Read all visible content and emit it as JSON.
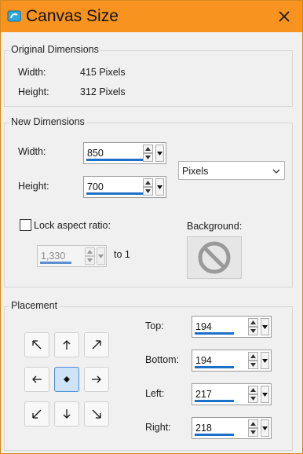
{
  "window": {
    "title": "Canvas Size"
  },
  "original": {
    "title": "Original Dimensions",
    "width_label": "Width:",
    "width_value": "415 Pixels",
    "height_label": "Height:",
    "height_value": "312 Pixels"
  },
  "new_dims": {
    "title": "New Dimensions",
    "width_label": "Width:",
    "width_value": "850",
    "height_label": "Height:",
    "height_value": "700",
    "units_value": "Pixels",
    "lock_label": "Lock aspect ratio:",
    "lock_checked": false,
    "ratio_value": "1,330",
    "ratio_suffix": "to 1",
    "background_label": "Background:"
  },
  "placement": {
    "title": "Placement",
    "selected": "center",
    "top_label": "Top:",
    "top_value": "194",
    "bottom_label": "Bottom:",
    "bottom_value": "194",
    "left_label": "Left:",
    "left_value": "217",
    "right_label": "Right:",
    "right_value": "218"
  },
  "icons": {
    "app": "canvas-app-icon",
    "close": "close-icon",
    "spin_up": "spin-up-icon",
    "spin_down": "spin-down-icon",
    "dropdown": "dropdown-icon",
    "chevron": "chevron-down-icon",
    "no_background": "no-background-icon"
  },
  "colors": {
    "titlebar": "#f7931e",
    "accent_bar": "#1e6fc7",
    "active_button": "#cfe3f7"
  }
}
